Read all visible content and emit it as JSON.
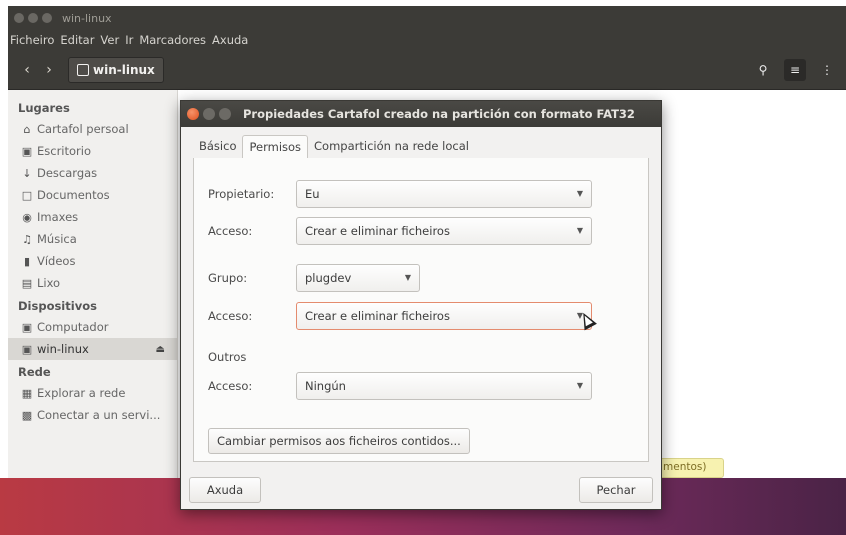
{
  "window": {
    "title": "win-linux",
    "menu": [
      "Ficheiro",
      "Editar",
      "Ver",
      "Ir",
      "Marcadores",
      "Axuda"
    ],
    "path_button": "win-linux"
  },
  "sidebar": {
    "places_header": "Lugares",
    "places": [
      {
        "label": "Cartafol persoal",
        "icon": "home-icon"
      },
      {
        "label": "Escritorio",
        "icon": "desktop-icon"
      },
      {
        "label": "Descargas",
        "icon": "download-icon"
      },
      {
        "label": "Documentos",
        "icon": "document-icon"
      },
      {
        "label": "Imaxes",
        "icon": "camera-icon"
      },
      {
        "label": "Música",
        "icon": "music-icon"
      },
      {
        "label": "Vídeos",
        "icon": "video-icon"
      },
      {
        "label": "Lixo",
        "icon": "trash-icon"
      }
    ],
    "devices_header": "Dispositivos",
    "devices": [
      {
        "label": "Computador",
        "icon": "drive-icon"
      },
      {
        "label": "win-linux",
        "icon": "drive-icon"
      }
    ],
    "network_header": "Rede",
    "network": [
      {
        "label": "Explorar a rede",
        "icon": "network-icon"
      },
      {
        "label": "Conectar a un servi...",
        "icon": "server-icon"
      }
    ]
  },
  "status_fragment": "mentos)",
  "dialog": {
    "title": "Propiedades Cartafol creado na partición con formato FAT32",
    "tabs": [
      "Básico",
      "Permisos",
      "Compartición na rede local"
    ],
    "owner_label": "Propietario:",
    "owner_value": "Eu",
    "owner_access_label": "Acceso:",
    "owner_access_value": "Crear e eliminar ficheiros",
    "group_label": "Grupo:",
    "group_value": "plugdev",
    "group_access_label": "Acceso:",
    "group_access_value": "Crear e eliminar ficheiros",
    "others_label": "Outros",
    "others_access_label": "Acceso:",
    "others_access_value": "Ningún",
    "change_perms_button": "Cambiar permisos aos ficheiros contidos...",
    "help_button": "Axuda",
    "close_button": "Pechar"
  },
  "colors": {
    "titlebar": "#3c3b37",
    "close_button": "#e0501e",
    "focus_border": "#e48b6e"
  }
}
